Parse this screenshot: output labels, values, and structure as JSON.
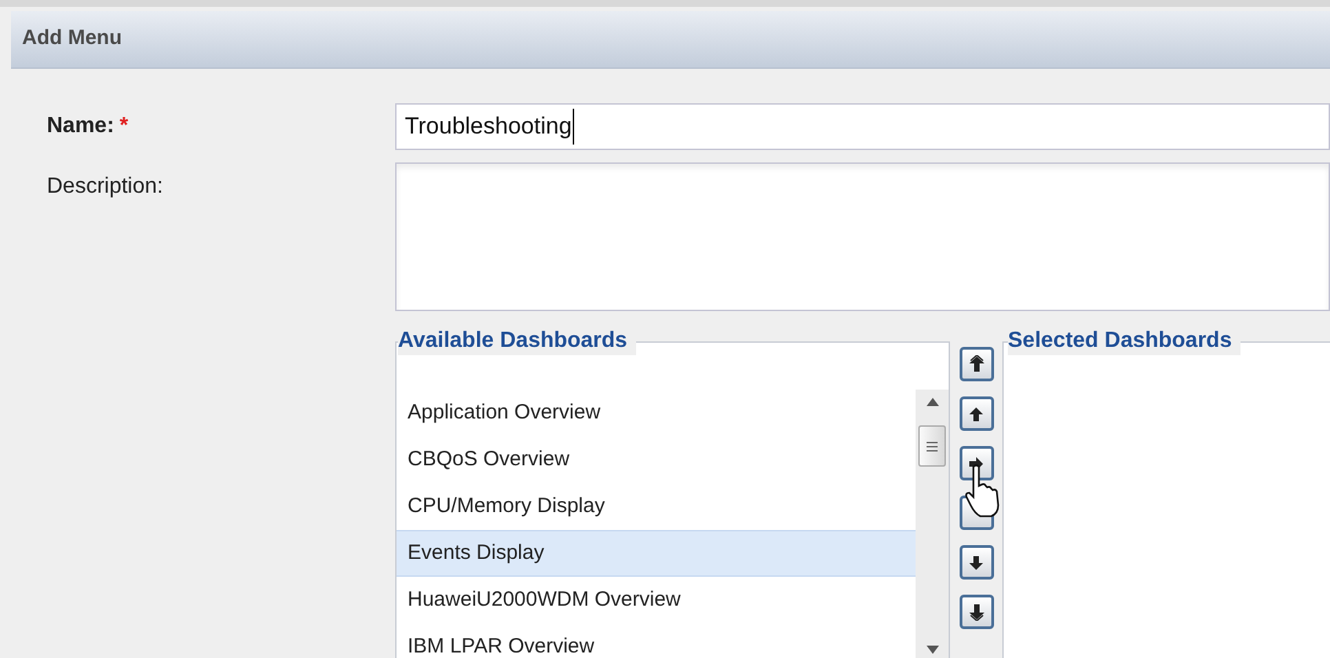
{
  "panel": {
    "title": "Add Menu"
  },
  "name_field": {
    "label": "Name:",
    "required_mark": "*",
    "value": "Troubleshooting"
  },
  "description_field": {
    "label": "Description:"
  },
  "available": {
    "legend": "Available Dashboards",
    "items": [
      {
        "label": "Application Overview",
        "selected": false
      },
      {
        "label": "CBQoS Overview",
        "selected": false
      },
      {
        "label": "CPU/Memory Display",
        "selected": false
      },
      {
        "label": "Events Display",
        "selected": true
      },
      {
        "label": "HuaweiU2000WDM Overview",
        "selected": false
      },
      {
        "label": "IBM LPAR Overview",
        "selected": false
      }
    ]
  },
  "selected": {
    "legend": "Selected Dashboards"
  }
}
